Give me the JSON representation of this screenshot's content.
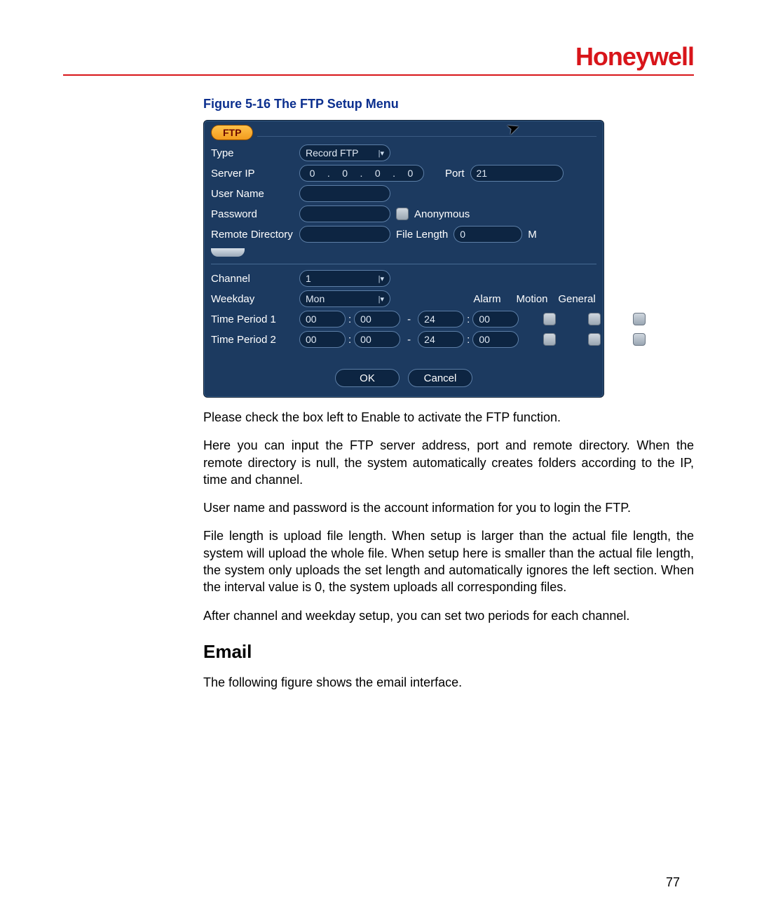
{
  "header": {
    "brand": "Honeywell"
  },
  "caption": "Figure 5-16 The FTP Setup Menu",
  "ftp": {
    "tab_label": "FTP",
    "labels": {
      "type": "Type",
      "server_ip": "Server IP",
      "port": "Port",
      "user_name": "User Name",
      "password": "Password",
      "anonymous": "Anonymous",
      "remote_dir": "Remote Directory",
      "file_length": "File Length",
      "file_length_unit": "M",
      "channel": "Channel",
      "weekday": "Weekday",
      "alarm": "Alarm",
      "motion": "Motion",
      "general": "General",
      "tp1": "Time Period 1",
      "tp2": "Time Period 2"
    },
    "type_value": "Record FTP",
    "ip_octets": [
      "0",
      "0",
      "0",
      "0"
    ],
    "port_value": "21",
    "user_name_value": "",
    "password_value": "",
    "anonymous_checked": false,
    "remote_dir_value": "",
    "file_length_value": "0",
    "channel_value": "1",
    "weekday_value": "Mon",
    "tp1_start_h": "00",
    "tp1_start_m": "00",
    "tp1_end_h": "24",
    "tp1_end_m": "00",
    "tp2_start_h": "00",
    "tp2_start_m": "00",
    "tp2_end_h": "24",
    "tp2_end_m": "00",
    "buttons": {
      "ok": "OK",
      "cancel": "Cancel"
    }
  },
  "body": {
    "p1": "Please check the box left to Enable to activate the FTP function.",
    "p2": "Here you can input the FTP server address, port and remote directory. When the remote directory is null, the system automatically creates folders according to the IP, time and channel.",
    "p3": "User name and password is the account information for you to login the FTP.",
    "p4": "File length is upload file length. When setup is larger than the actual file length, the system will upload the whole file. When setup here is smaller than the actual file length, the system only uploads the set length and automatically ignores the left section. When the interval value is 0, the system uploads all corresponding files.",
    "p5": "After channel and weekday setup, you can set two periods for each channel.",
    "email_heading": "Email",
    "p6": "The following figure shows the email interface."
  },
  "page_number": "77"
}
